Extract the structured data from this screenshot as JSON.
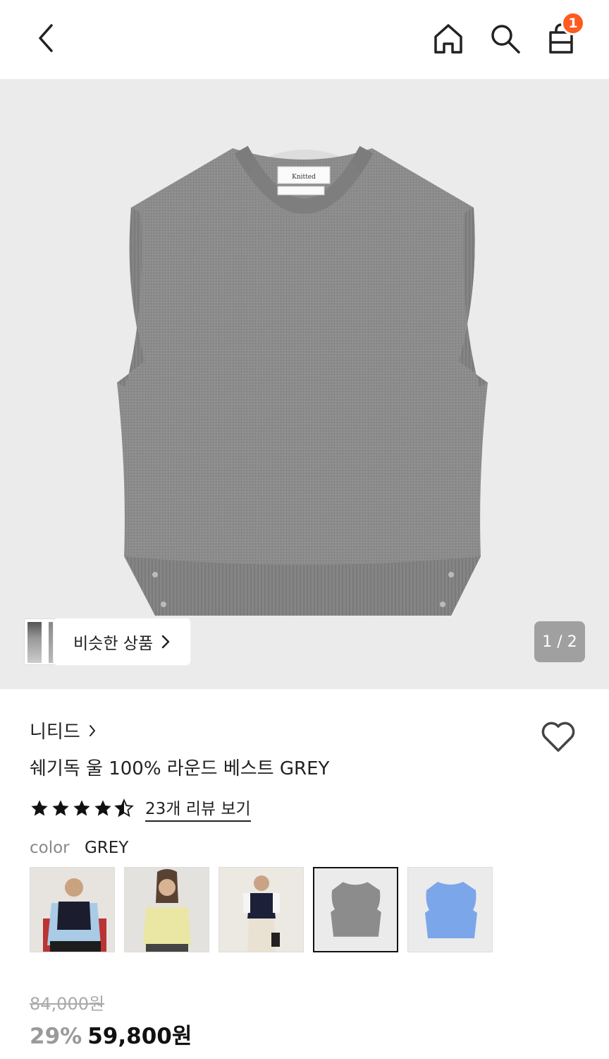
{
  "header": {
    "cart_count": "1"
  },
  "gallery": {
    "similar_label": "비슷한 상품",
    "counter": "1 / 2",
    "tag_text": "Knitted"
  },
  "product": {
    "brand": "니티드",
    "title": "쉐기독 울 100% 라운드 베스트 GREY",
    "rating": 4.5,
    "reviews_label": "23개 리뷰 보기",
    "color_label": "color",
    "color_value": "GREY",
    "swatches": [
      "navy-vest-on-model",
      "yellow-vest-on-model",
      "navy-vest-model-2",
      "grey-vest",
      "blue-vest"
    ],
    "original_price": "84,000원",
    "discount": "29%",
    "sale_price": "59,800원"
  },
  "colors": {
    "accent": "#ff5a1f",
    "hero_bg": "#ebebeb",
    "vest_grey": "#8a8a8a"
  }
}
